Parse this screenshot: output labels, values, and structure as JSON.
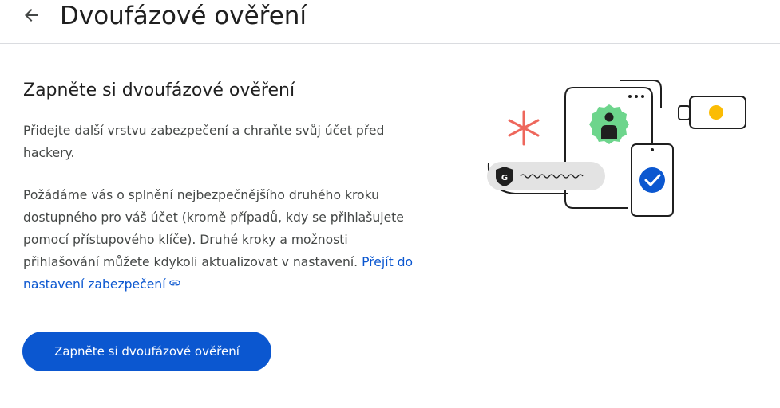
{
  "header": {
    "title": "Dvoufázové ověření",
    "back_icon": "arrow-back-icon"
  },
  "main": {
    "heading": "Zapněte si dvoufázové ověření",
    "paragraph1": "Přidejte další vrstvu zabezpečení a chraňte svůj účet před hackery.",
    "paragraph2": "Požádáme vás o splnění nejbezpečnějšího druhého kroku dostupného pro váš účet (kromě případů, kdy se přihlašujete pomocí přístupového klíče). Druhé kroky a možnosti přihlašování můžete kdykoli aktualizovat v nastavení.",
    "link_label": "Přejít do nastavení zabezpečení",
    "link_icon": "link-icon",
    "cta_label": "Zapněte si dvoufázové ověření"
  },
  "illustration": {
    "badge_letter": "G",
    "icons": [
      "asterisk-icon",
      "shield-icon",
      "user-badge-icon",
      "security-key-icon",
      "phone-icon",
      "checkmark-icon"
    ]
  },
  "colors": {
    "accent": "#0b57d0",
    "green_badge": "#6dd58c",
    "asterisk_red": "#ee675c",
    "key_yellow": "#fbbc04",
    "pill_gray": "#e3e3e3"
  }
}
